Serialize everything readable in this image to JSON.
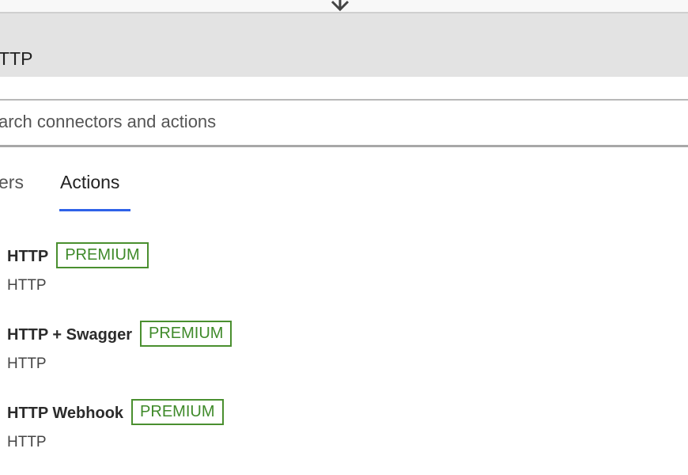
{
  "header": {
    "title": "TTP"
  },
  "search": {
    "placeholder": "arch connectors and actions"
  },
  "tabs": [
    {
      "label": "ers",
      "selected": false
    },
    {
      "label": "Actions",
      "selected": true
    }
  ],
  "colors": {
    "accent": "#2f62e8",
    "premium": "#3f8a2a",
    "header_bg": "#e3e3e3"
  },
  "actions": [
    {
      "title": "HTTP",
      "badge": "PREMIUM",
      "connector": "HTTP"
    },
    {
      "title": "HTTP + Swagger",
      "badge": "PREMIUM",
      "connector": "HTTP"
    },
    {
      "title": "HTTP Webhook",
      "badge": "PREMIUM",
      "connector": "HTTP"
    }
  ]
}
